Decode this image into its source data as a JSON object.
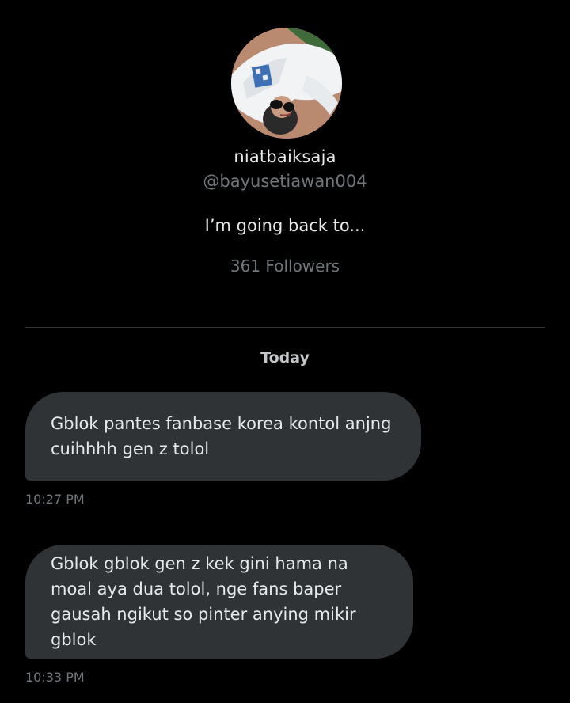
{
  "profile": {
    "display_name": "niatbaiksaja",
    "handle": "@bayusetiawan004",
    "bio": "I’m going back to...",
    "followers": "361 Followers"
  },
  "conversation": {
    "day_label": "Today",
    "messages": [
      {
        "text": "Gblok pantes fanbase korea kontol anjng cuihhhh gen z tolol",
        "time": "10:27 PM"
      },
      {
        "text": "Gblok gblok gen z kek gini hama na moal aya dua tolol, nge fans baper gausah ngikut so pinter anying mikir gblok",
        "time": "10:33 PM"
      }
    ]
  },
  "colors": {
    "background": "#000000",
    "primary_text": "#e7e9ea",
    "secondary_text": "#71767b",
    "bubble": "#2f3336",
    "divider": "#2f3336"
  }
}
